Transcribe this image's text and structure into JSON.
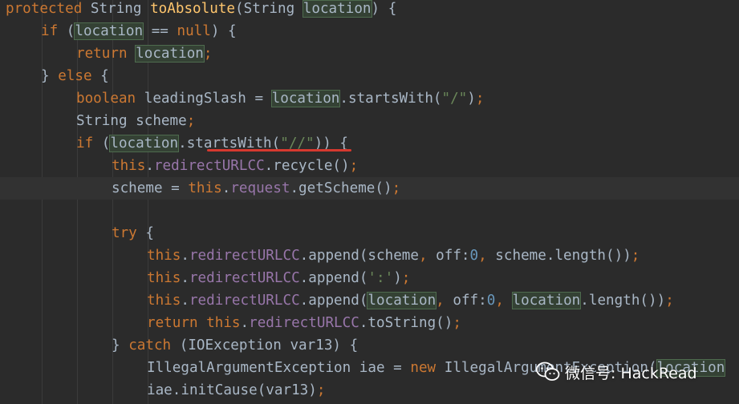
{
  "editor": {
    "lines": [
      "protected String toAbsolute(String location) {",
      "if (location == null) {",
      "return location;",
      "} else {",
      "boolean leadingSlash = location.startsWith(\"/\");",
      "String scheme;",
      "if (location.startsWith(\"//\")) {",
      "this.redirectURLCC.recycle();",
      "scheme = this.request.getScheme();",
      "",
      "try {",
      "this.redirectURLCC.append(scheme, off: 0, scheme.length());",
      "this.redirectURLCC.append(':');",
      "this.redirectURLCC.append(location, off: 0, location.length());",
      "return this.redirectURLCC.toString();",
      "} catch (IOException var13) {",
      "IllegalArgumentException iae = new IllegalArgumentException(location",
      "iae.initCause(var13);"
    ],
    "param_hint": "off:"
  },
  "watermark": {
    "text": "微信号: HackRead",
    "icon": "wechat-icon"
  },
  "colors": {
    "background": "#2b2b2b",
    "keyword": "#cc7832",
    "method": "#ffc66d",
    "field": "#9876aa",
    "string": "#6a8759",
    "number": "#6897bb",
    "text": "#a9b7c6",
    "highlight": "#344134",
    "underline": "#d6392f"
  }
}
